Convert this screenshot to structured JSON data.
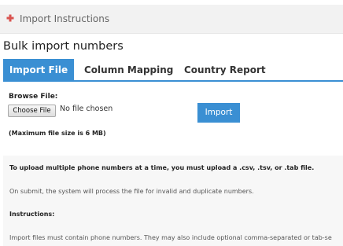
{
  "header": {
    "title": "Import Instructions",
    "icon": "plus-icon",
    "icon_color": "#d9534f"
  },
  "page": {
    "title": "Bulk import numbers"
  },
  "tabs": [
    {
      "label": "Import File",
      "active": true
    },
    {
      "label": "Column Mapping",
      "active": false
    },
    {
      "label": "Country Report",
      "active": false
    }
  ],
  "form": {
    "browse_label": "Browse File:",
    "choose_button": "Choose File",
    "no_file_text": "No file chosen",
    "import_button": "Import",
    "max_size_note": "(Maximum file size is 6 MB)"
  },
  "instructions": {
    "line1": "To upload multiple phone numbers at a time, you must upload a .csv, .tsv, or .tab file.",
    "line2": "On submit, the system will process the file for invalid and duplicate numbers.",
    "heading": "Instructions:",
    "line3": "Import files must contain phone numbers. They may also include optional comma-separated or tab-se"
  },
  "colors": {
    "accent": "#3a8fd3",
    "panel_bg": "#f7f7f7"
  }
}
